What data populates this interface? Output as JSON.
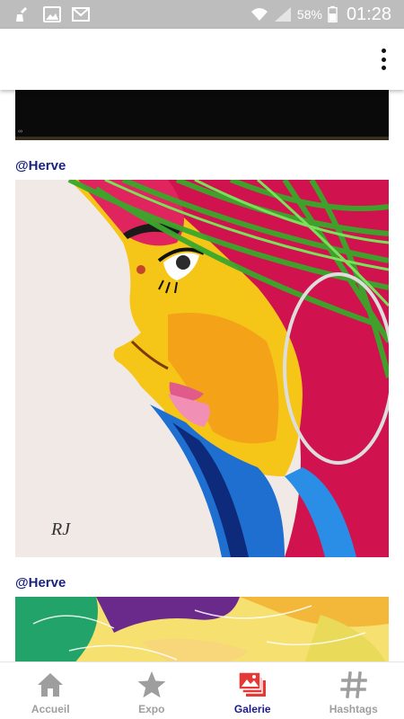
{
  "status_bar": {
    "battery_percent": "58%",
    "time": "01:28",
    "icons": [
      "broom-icon",
      "image-icon",
      "gmail-icon",
      "wifi-icon",
      "signal-icon",
      "battery-icon"
    ]
  },
  "app_bar": {
    "menu_icon": "more-vert-icon"
  },
  "feed": {
    "posts": [
      {
        "author": "@Herve",
        "image": "black-canvas-painting"
      },
      {
        "author": "@Herve",
        "image": "profile-woman-painting"
      },
      {
        "author": "@Herve",
        "image": "abstract-colorful-painting"
      }
    ]
  },
  "bottom_nav": {
    "items": [
      {
        "label": "Accueil",
        "icon": "home-icon",
        "active": false
      },
      {
        "label": "Expo",
        "icon": "star-icon",
        "active": false
      },
      {
        "label": "Galerie",
        "icon": "gallery-icon",
        "active": true
      },
      {
        "label": "Hashtags",
        "icon": "hash-icon",
        "active": false
      }
    ],
    "active_color": "#1a1a8c",
    "inactive_color": "#9e9e9e",
    "gallery_icon_color": "#e53935"
  }
}
